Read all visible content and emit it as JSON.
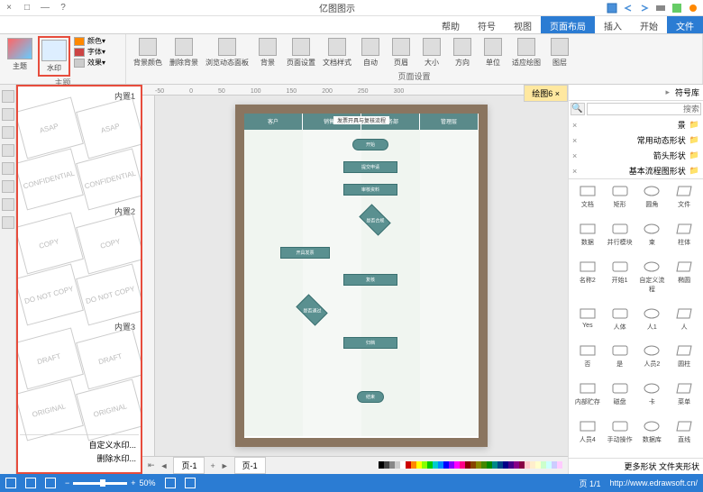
{
  "app": {
    "title": "亿图图示"
  },
  "window_controls": {
    "close": "×",
    "max": "□",
    "min": "—",
    "help": "?"
  },
  "tabs": {
    "items": [
      "文件",
      "开始",
      "插入",
      "页面布局",
      "视图",
      "符号",
      "帮助"
    ],
    "active": "页面布局"
  },
  "ribbon": {
    "group_theme": {
      "label": "主题",
      "theme_btn": "主题",
      "color_btn": "颜色▾",
      "font_btn": "字体▾",
      "effect_btn": "效果▾"
    },
    "group_bg": {
      "label": "页面设置",
      "items": [
        "背景颜色",
        "删除背景",
        "浏览动态面板",
        "背景",
        "页面设置",
        "文档样式",
        "自动",
        "页眉",
        "大小",
        "方向",
        "单位",
        "适应绘图",
        "图层"
      ]
    },
    "watermark_btn": "水印"
  },
  "doc_tab": {
    "name": "绘图6",
    "close": "×"
  },
  "ruler_marks": [
    "-50",
    "0",
    "50",
    "100",
    "150",
    "200",
    "250",
    "300"
  ],
  "watermarks": {
    "section1": "内置1",
    "section2": "内置2",
    "section3": "内置3",
    "items1": [
      "ASAP",
      "ASAP",
      "CONFIDENTIAL",
      "CONFIDENTIAL"
    ],
    "items2": [
      "COPY",
      "COPY",
      "DO NOT COPY",
      "DO NOT COPY"
    ],
    "items3": [
      "DRAFT",
      "DRAFT",
      "ORIGINAL",
      "ORIGINAL"
    ],
    "custom1": "自定义水印...",
    "custom2": "删除水印..."
  },
  "flowchart": {
    "title": "发票开具与复核流程",
    "lanes": [
      "客户",
      "销售部",
      "财务部",
      "管理层"
    ],
    "nodes": [
      "开始",
      "提交申请",
      "审核资料",
      "是否合规",
      "开具发票",
      "复核",
      "是否通过",
      "归档",
      "结束"
    ]
  },
  "canvas_tabs": {
    "page1": "页-1",
    "add": "+",
    "nav_first": "⇤",
    "nav_prev": "◄",
    "nav_next": "►"
  },
  "right_panel": {
    "title": "符号库",
    "search_placeholder": "搜索",
    "stencils": [
      "景",
      "常用动态形状",
      "箭头形状",
      "基本流程图形状"
    ],
    "shapes": [
      "文档",
      "矩形",
      "圆角",
      "文件",
      "数据",
      "并行模块",
      "束",
      "柱体",
      "名称2",
      "开始1",
      "自定义流程",
      "椭圆",
      "Yes",
      "人体",
      "人1",
      "人",
      "否",
      "是",
      "人员2",
      "圆柱",
      "内部贮存",
      "磁盘",
      "卡",
      "菜单",
      "人员4",
      "手动操作",
      "数据库",
      "直线"
    ],
    "footer": [
      "更多形状",
      "文件夹形状"
    ]
  },
  "statusbar": {
    "url": "http://www.edrawsoft.cn/",
    "page_info": "页 1/1",
    "zoom": "50%",
    "zoom_minus": "−",
    "zoom_plus": "+"
  },
  "colors": [
    "#000",
    "#444",
    "#888",
    "#ccc",
    "#fff",
    "#c00",
    "#f80",
    "#ff0",
    "#8f0",
    "#0c0",
    "#0cc",
    "#08f",
    "#00f",
    "#80f",
    "#f0f",
    "#f08",
    "#800",
    "#840",
    "#880",
    "#480",
    "#080",
    "#088",
    "#048",
    "#008",
    "#408",
    "#808",
    "#804",
    "#fcc",
    "#fec",
    "#ffc",
    "#cfc",
    "#cff",
    "#ccf",
    "#fcf"
  ]
}
